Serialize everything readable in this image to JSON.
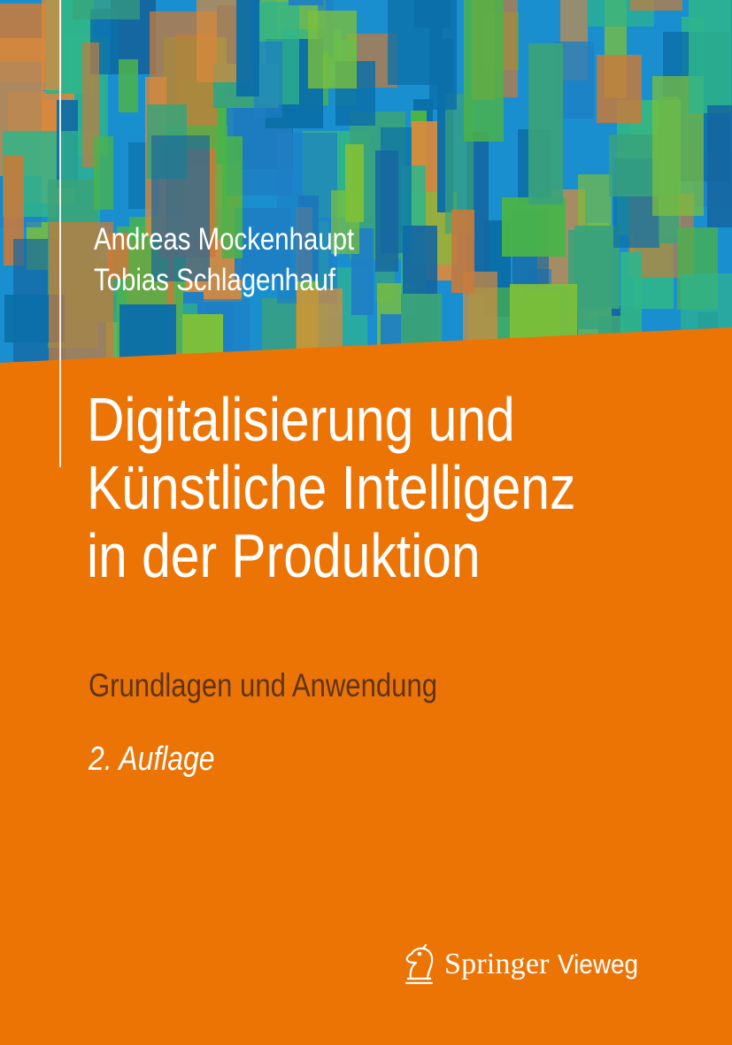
{
  "book": {
    "authors": [
      "Andreas Mockenhaupt",
      "Tobias Schlagenhauf"
    ],
    "title_lines": [
      "Digitalisierung und",
      "Künstliche Intelligenz",
      "in der Produktion"
    ],
    "subtitle": "Grundlagen und Anwendung",
    "edition": "2. Auflage"
  },
  "publisher": {
    "name": "Springer",
    "imprint": "Vieweg",
    "logo_icon": "chess-knight-icon"
  },
  "colors": {
    "cover_orange": "#ec7404",
    "subtitle_brown": "#5e3415",
    "text_white": "#ffffff",
    "pattern_blue": "#1a8fcf",
    "pattern_green": "#4ab34a",
    "pattern_orange": "#d98a3c"
  }
}
